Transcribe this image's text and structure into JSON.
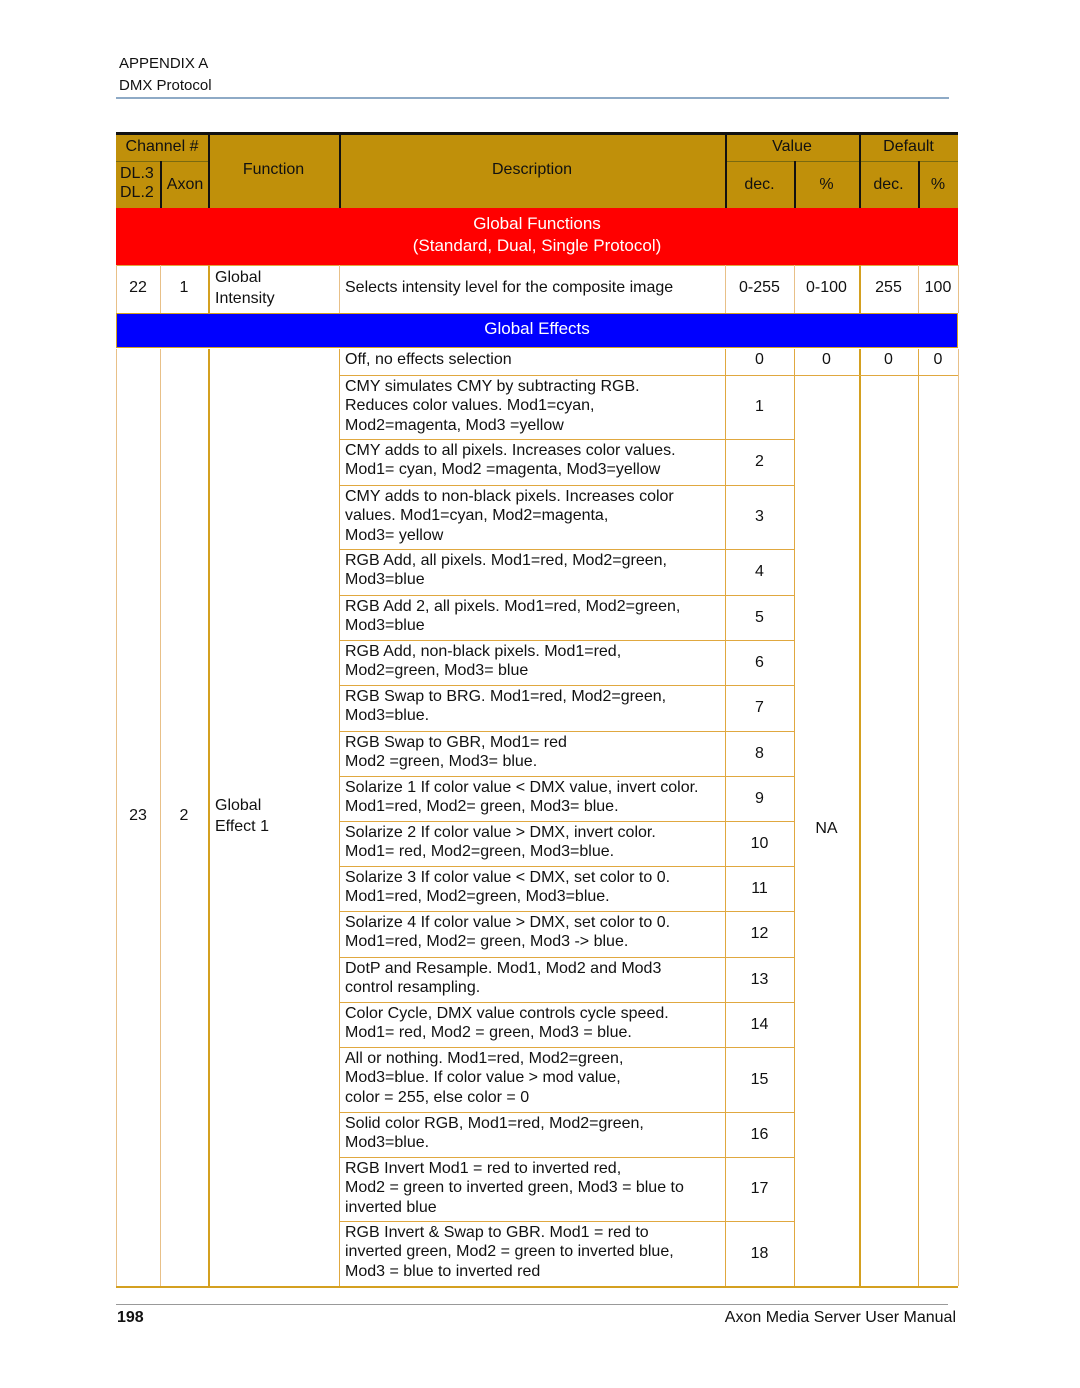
{
  "header": {
    "title": "APPENDIX A",
    "subtitle": "DMX Protocol"
  },
  "table": {
    "columns": {
      "channel": "Channel #",
      "dl": "DL.3\nDL.2",
      "dl3": "DL.3",
      "dl2": "DL.2",
      "axon": "Axon",
      "function": "Function",
      "description": "Description",
      "value": "Value",
      "default": "Default",
      "dec": "dec.",
      "pct": "%",
      "default_dec": "dec.",
      "default_pct": "%"
    },
    "sections": [
      {
        "title_line1": "Global Functions",
        "title_line2": "(Standard, Dual, Single Protocol)",
        "color": "#ff0000"
      },
      {
        "title_line1": "Global Effects",
        "color": "#0000ff"
      }
    ],
    "global_intensity": {
      "dl": "22",
      "axon": "1",
      "function_line1": "Global",
      "function_line2": "Intensity",
      "description": "Selects intensity level for the composite image",
      "value_dec": "0-255",
      "value_pct": "0-100",
      "default_dec": "255",
      "default_pct": "100"
    },
    "global_effect": {
      "dl": "23",
      "axon": "2",
      "function_line1": "Global",
      "function_line2": "Effect 1",
      "value_pct": "NA",
      "first_row": {
        "description": "Off, no effects selection",
        "value_dec": "0",
        "value_pct": "0",
        "default_dec": "0",
        "default_pct": "0"
      },
      "rows": [
        {
          "lines": [
            "CMY simulates CMY by subtracting RGB.",
            "Reduces color values. Mod1=cyan,",
            "Mod2=magenta, Mod3 =yellow"
          ],
          "dec": "1"
        },
        {
          "lines": [
            "CMY adds to all pixels. Increases color values.",
            "Mod1= cyan, Mod2 =magenta, Mod3=yellow"
          ],
          "dec": "2"
        },
        {
          "lines": [
            "CMY adds to non-black pixels. Increases color",
            "values. Mod1=cyan, Mod2=magenta,",
            "Mod3= yellow"
          ],
          "dec": "3"
        },
        {
          "lines": [
            "RGB Add, all pixels. Mod1=red, Mod2=green,",
            "Mod3=blue"
          ],
          "dec": "4"
        },
        {
          "lines": [
            "RGB Add 2, all pixels. Mod1=red, Mod2=green,",
            "Mod3=blue"
          ],
          "dec": "5"
        },
        {
          "lines": [
            "RGB Add, non-black pixels. Mod1=red,",
            "Mod2=green, Mod3= blue"
          ],
          "dec": "6"
        },
        {
          "lines": [
            "RGB Swap to BRG. Mod1=red, Mod2=green,",
            "Mod3=blue."
          ],
          "dec": "7"
        },
        {
          "lines": [
            "RGB Swap to GBR, Mod1= red",
            "Mod2 =green, Mod3= blue."
          ],
          "dec": "8"
        },
        {
          "lines": [
            "Solarize 1 If color value < DMX value, invert color.",
            "Mod1=red, Mod2= green, Mod3= blue."
          ],
          "dec": "9"
        },
        {
          "lines": [
            "Solarize 2 If color value > DMX, invert color.",
            "Mod1= red, Mod2=green, Mod3=blue."
          ],
          "dec": "10"
        },
        {
          "lines": [
            "Solarize 3 If color value < DMX, set color to 0.",
            "Mod1=red, Mod2=green, Mod3=blue."
          ],
          "dec": "11"
        },
        {
          "lines": [
            "Solarize 4 If color value > DMX, set color to 0.",
            "Mod1=red, Mod2= green, Mod3 -> blue."
          ],
          "dec": "12"
        },
        {
          "lines": [
            "DotP and Resample. Mod1, Mod2 and Mod3",
            "control resampling."
          ],
          "dec": "13"
        },
        {
          "lines": [
            "Color Cycle, DMX value controls cycle speed.",
            "Mod1= red, Mod2 = green, Mod3 = blue."
          ],
          "dec": "14"
        },
        {
          "lines": [
            "All or nothing. Mod1=red, Mod2=green,",
            "Mod3=blue. If color value > mod value,",
            "color = 255, else color = 0"
          ],
          "dec": "15"
        },
        {
          "lines": [
            "Solid color RGB, Mod1=red, Mod2=green,",
            "Mod3=blue."
          ],
          "dec": "16"
        },
        {
          "lines": [
            "RGB Invert Mod1 = red to inverted red,",
            "Mod2 = green to inverted green, Mod3 = blue to",
            "inverted blue"
          ],
          "dec": "17"
        },
        {
          "lines": [
            "RGB Invert & Swap to GBR. Mod1 = red to",
            "inverted green, Mod2 = green to inverted blue,",
            "Mod3 = blue to inverted red"
          ],
          "dec": "18"
        }
      ]
    }
  },
  "footer": {
    "page_number": "198",
    "manual_title": "Axon Media Server User Manual"
  },
  "colors": {
    "header_bg": "#c0900a",
    "global_functions_band": "#ff0000",
    "global_effects_band": "#0000ff",
    "header_rule": "#8eaac6",
    "cell_border": "#e0a840"
  }
}
